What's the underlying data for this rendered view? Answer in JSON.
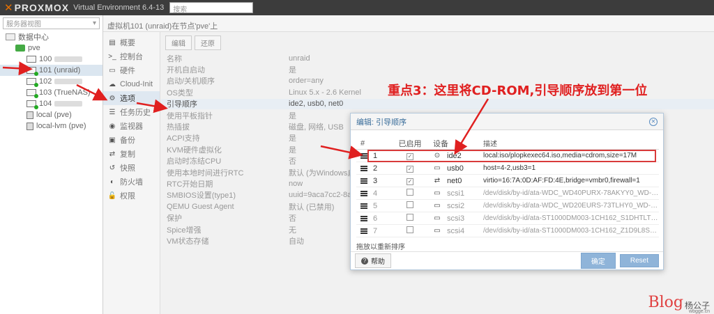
{
  "header": {
    "logo_x": "✕",
    "logo_text": "PROXMOX",
    "product": "Virtual Environment 6.4-13",
    "search_placeholder": "搜索"
  },
  "tree": {
    "view_selector": "服务器视图",
    "datacenter": "数据中心",
    "node": "pve",
    "items": [
      {
        "label": "100",
        "blurred": true,
        "selected": false,
        "running": false
      },
      {
        "label": "101 (unraid)",
        "blurred": false,
        "selected": true,
        "running": true
      },
      {
        "label": "102",
        "blurred": true,
        "selected": false,
        "running": true
      },
      {
        "label": "103 (TrueNAS)",
        "blurred": false,
        "selected": false,
        "running": true
      },
      {
        "label": "104",
        "blurred": true,
        "selected": false,
        "running": true
      }
    ],
    "storages": [
      "local (pve)",
      "local-lvm (pve)"
    ]
  },
  "breadcrumb": "虚拟机101 (unraid)在节点'pve'上",
  "menu": [
    {
      "label": "概要",
      "icon": "▤",
      "selected": false
    },
    {
      "label": "控制台",
      "icon": ">_",
      "selected": false
    },
    {
      "label": "硬件",
      "icon": "▭",
      "selected": false
    },
    {
      "label": "Cloud-Init",
      "icon": "☁",
      "selected": false
    },
    {
      "label": "选项",
      "icon": "⚙",
      "selected": true
    },
    {
      "label": "任务历史",
      "icon": "☰",
      "selected": false
    },
    {
      "label": "监视器",
      "icon": "◉",
      "selected": false
    },
    {
      "label": "备份",
      "icon": "▣",
      "selected": false
    },
    {
      "label": "复制",
      "icon": "⇄",
      "selected": false
    },
    {
      "label": "快照",
      "icon": "↺",
      "selected": false
    },
    {
      "label": "防火墙",
      "icon": "◐",
      "selected": false
    },
    {
      "label": "权限",
      "icon": "🔓",
      "selected": false
    }
  ],
  "toolbar": {
    "edit": "编辑",
    "revert": "还原"
  },
  "options": [
    {
      "key": "名称",
      "value": "unraid"
    },
    {
      "key": "开机自启动",
      "value": "是"
    },
    {
      "key": "启动/关机顺序",
      "value": "order=any"
    },
    {
      "key": "OS类型",
      "value": "Linux 5.x - 2.6 Kernel"
    },
    {
      "key": "引导顺序",
      "value": "ide2, usb0, net0",
      "selected": true
    },
    {
      "key": "使用平板指针",
      "value": "是"
    },
    {
      "key": "热插拔",
      "value": "磁盘, 网络, USB"
    },
    {
      "key": "ACPI支持",
      "value": "是"
    },
    {
      "key": "KVM硬件虚拟化",
      "value": "是"
    },
    {
      "key": "启动时冻结CPU",
      "value": "否"
    },
    {
      "key": "使用本地时间进行RTC",
      "value": "默认 (为Windows启用"
    },
    {
      "key": "RTC开始日期",
      "value": "now"
    },
    {
      "key": "SMBIOS设置(type1)",
      "value": "uuid=9aca7cc2-8ae6"
    },
    {
      "key": "QEMU Guest Agent",
      "value": "默认 (已禁用)"
    },
    {
      "key": "保护",
      "value": "否"
    },
    {
      "key": "Spice增强",
      "value": "无"
    },
    {
      "key": "VM状态存储",
      "value": "自动"
    }
  ],
  "dialog": {
    "title": "编辑: 引导顺序",
    "columns": {
      "num": "#",
      "enabled": "已启用",
      "device": "设备",
      "desc": "描述"
    },
    "rows": [
      {
        "num": "1",
        "enabled": true,
        "device": "ide2",
        "icon": "⊙",
        "desc": "local:iso/plopkexec64.iso,media=cdrom,size=17M"
      },
      {
        "num": "2",
        "enabled": true,
        "device": "usb0",
        "icon": "▭",
        "desc": "host=4-2,usb3=1"
      },
      {
        "num": "3",
        "enabled": true,
        "device": "net0",
        "icon": "⇄",
        "desc": "virtio=16:7A:0D:AF:FD:4E,bridge=vmbr0,firewall=1"
      },
      {
        "num": "4",
        "enabled": false,
        "device": "scsi1",
        "icon": "▭",
        "desc": "/dev/disk/by-id/ata-WDC_WD40PURX-78AKYY0_WD-W..."
      },
      {
        "num": "5",
        "enabled": false,
        "device": "scsi2",
        "icon": "▭",
        "desc": "/dev/disk/by-id/ata-WDC_WD20EURS-73TLHY0_WD-W..."
      },
      {
        "num": "6",
        "enabled": false,
        "device": "scsi3",
        "icon": "▭",
        "desc": "/dev/disk/by-id/ata-ST1000DM003-1CH162_S1DHTLTT,..."
      },
      {
        "num": "7",
        "enabled": false,
        "device": "scsi4",
        "icon": "▭",
        "desc": "/dev/disk/by-id/ata-ST1000DM003-1CH162_Z1D9L8SW,..."
      }
    ],
    "drag_hint": "拖放以重新排序",
    "help": "帮助",
    "ok": "确定",
    "reset": "Reset"
  },
  "annotation": "重点3：这里将CD-ROM,引导顺序放到第一位",
  "watermark": {
    "blog": "Blog",
    "name": "杨公子",
    "site": "wbgge.cn"
  },
  "colors": {
    "accent_orange": "#e57000",
    "annotation_red": "#e02020",
    "button_blue": "#8fb4d9"
  }
}
